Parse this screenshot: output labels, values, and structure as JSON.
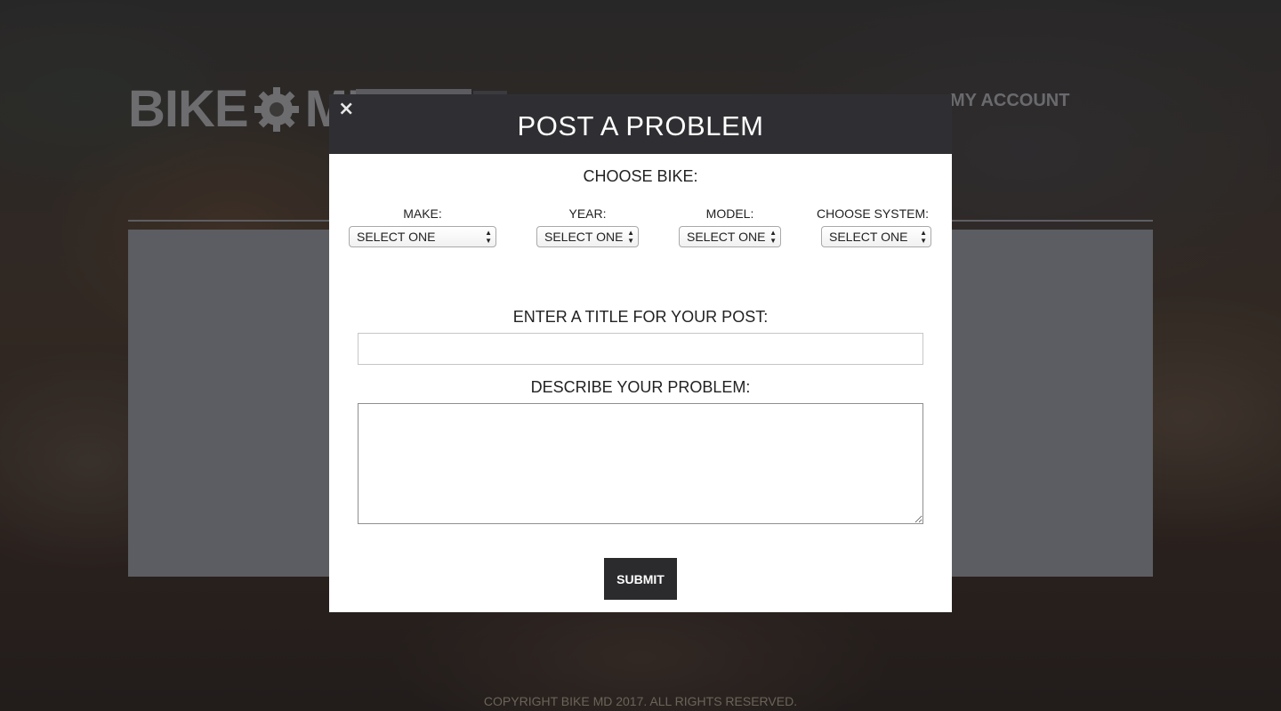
{
  "brand": {
    "logo_left": "BIKE",
    "logo_right": "MD"
  },
  "nav": {
    "account_label": "MY ACCOUNT"
  },
  "footer": {
    "copyright": "COPYRIGHT BIKE MD 2017. ALL RIGHTS RESERVED."
  },
  "modal": {
    "title": "POST A PROBLEM",
    "close_glyph": "×",
    "choose_bike_heading": "CHOOSE BIKE:",
    "fields": [
      {
        "label": "MAKE:",
        "value": "SELECT ONE"
      },
      {
        "label": "YEAR:",
        "value": "SELECT ONE"
      },
      {
        "label": "MODEL:",
        "value": "SELECT ONE"
      },
      {
        "label": "CHOOSE SYSTEM:",
        "value": "SELECT ONE"
      }
    ],
    "title_heading": "ENTER A TITLE FOR YOUR POST:",
    "title_value": "",
    "describe_heading": "DESCRIBE YOUR PROBLEM:",
    "describe_value": "",
    "submit_label": "SUBMIT"
  },
  "icons": {
    "close": "close-icon",
    "logo_gear": "gear-icon",
    "select_arrows": "updown-arrow-icon"
  },
  "colors": {
    "modal_header": "#2f2f33",
    "submit_bg": "#2b2b2e",
    "overlay_panel": "#5c5d62"
  }
}
